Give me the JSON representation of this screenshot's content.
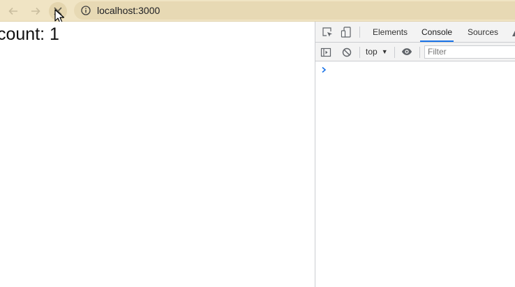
{
  "browser": {
    "url": "localhost:3000",
    "icons": {
      "back": "arrow-left-icon",
      "forward": "arrow-right-icon",
      "stop": "close-icon",
      "site_info": "info-icon"
    }
  },
  "page": {
    "count_text": "count: 1"
  },
  "devtools": {
    "tabs": [
      {
        "label": "Elements",
        "active": false
      },
      {
        "label": "Console",
        "active": true
      },
      {
        "label": "Sources",
        "active": false
      }
    ],
    "context_selector": "top",
    "filter_placeholder": "Filter",
    "accent_color": "#1a73e8"
  }
}
